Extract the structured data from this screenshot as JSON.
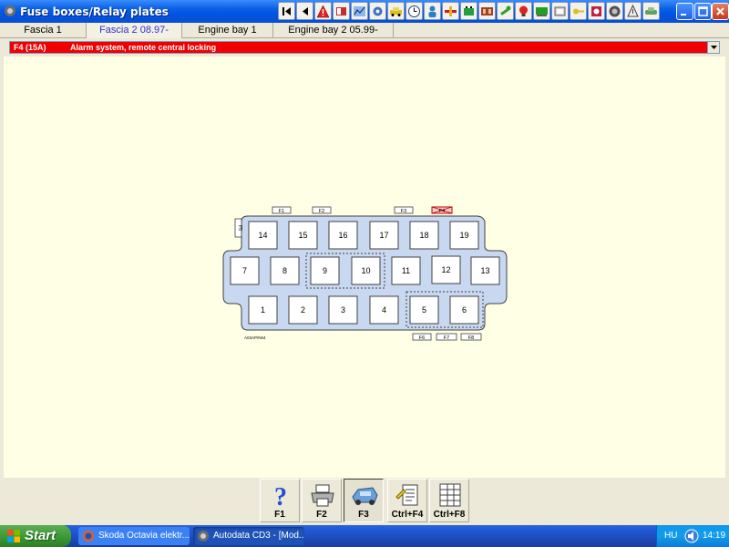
{
  "window": {
    "title": "Fuse boxes/Relay plates",
    "toolbar_icons": [
      "first-page-icon",
      "previous-page-icon",
      "warning-icon",
      "book-icon",
      "chart-icon",
      "gear-icon",
      "car-icon",
      "clock-icon",
      "person-icon",
      "tool-icon",
      "battery-icon",
      "engine-icon",
      "wrench-icon",
      "lamp-icon",
      "car-lift-icon",
      "fuse-icon",
      "key-icon",
      "ac-icon",
      "wheel-icon",
      "tyre-icon",
      "alert-icon",
      "car-body-icon"
    ],
    "colors": {
      "titlebar": "#0054e3",
      "combo_bg": "#f00000",
      "fuse_box": "#c8d8f0",
      "main_bg": "#ffffe6"
    }
  },
  "tabs": [
    {
      "label": "Fascia 1",
      "active": false
    },
    {
      "label": "Fascia 2 08.97-",
      "active": true
    },
    {
      "label": "Engine bay 1",
      "active": false
    },
    {
      "label": "Engine bay 2 05.99-",
      "active": false
    }
  ],
  "selection": {
    "code": "F4 (15A)",
    "description": "Alarm system, remote central locking"
  },
  "diagram": {
    "top_labels": [
      "F1",
      "F2",
      "F3",
      "F4"
    ],
    "bottom_labels": [
      "F6",
      "F7",
      "F8"
    ],
    "side_label": "F5",
    "footer_code": "A03AP/N64",
    "rows": [
      [
        "14",
        "15",
        "16",
        "17",
        "18",
        "19"
      ],
      [
        "7",
        "8",
        "9",
        "10",
        "11",
        "12",
        "13"
      ],
      [
        "1",
        "2",
        "3",
        "4",
        "5",
        "6"
      ]
    ],
    "highlighted_fuse": "F4"
  },
  "function_keys": [
    {
      "label": "F1",
      "icon": "help-icon",
      "pressed": false
    },
    {
      "label": "F2",
      "icon": "printer-icon",
      "pressed": false
    },
    {
      "label": "F3",
      "icon": "car-diagram-icon",
      "pressed": true
    },
    {
      "label": "Ctrl+F4",
      "icon": "notes-icon",
      "pressed": false
    },
    {
      "label": "Ctrl+F8",
      "icon": "table-icon",
      "pressed": false
    }
  ],
  "taskbar": {
    "start_label": "Start",
    "tasks": [
      {
        "label": "Skoda Octavia elektr...",
        "icon": "firefox-icon"
      },
      {
        "label": "Autodata CD3 - [Mod...",
        "icon": "autodata-icon"
      }
    ],
    "tray": {
      "language": "HU",
      "time": "14:19"
    }
  }
}
